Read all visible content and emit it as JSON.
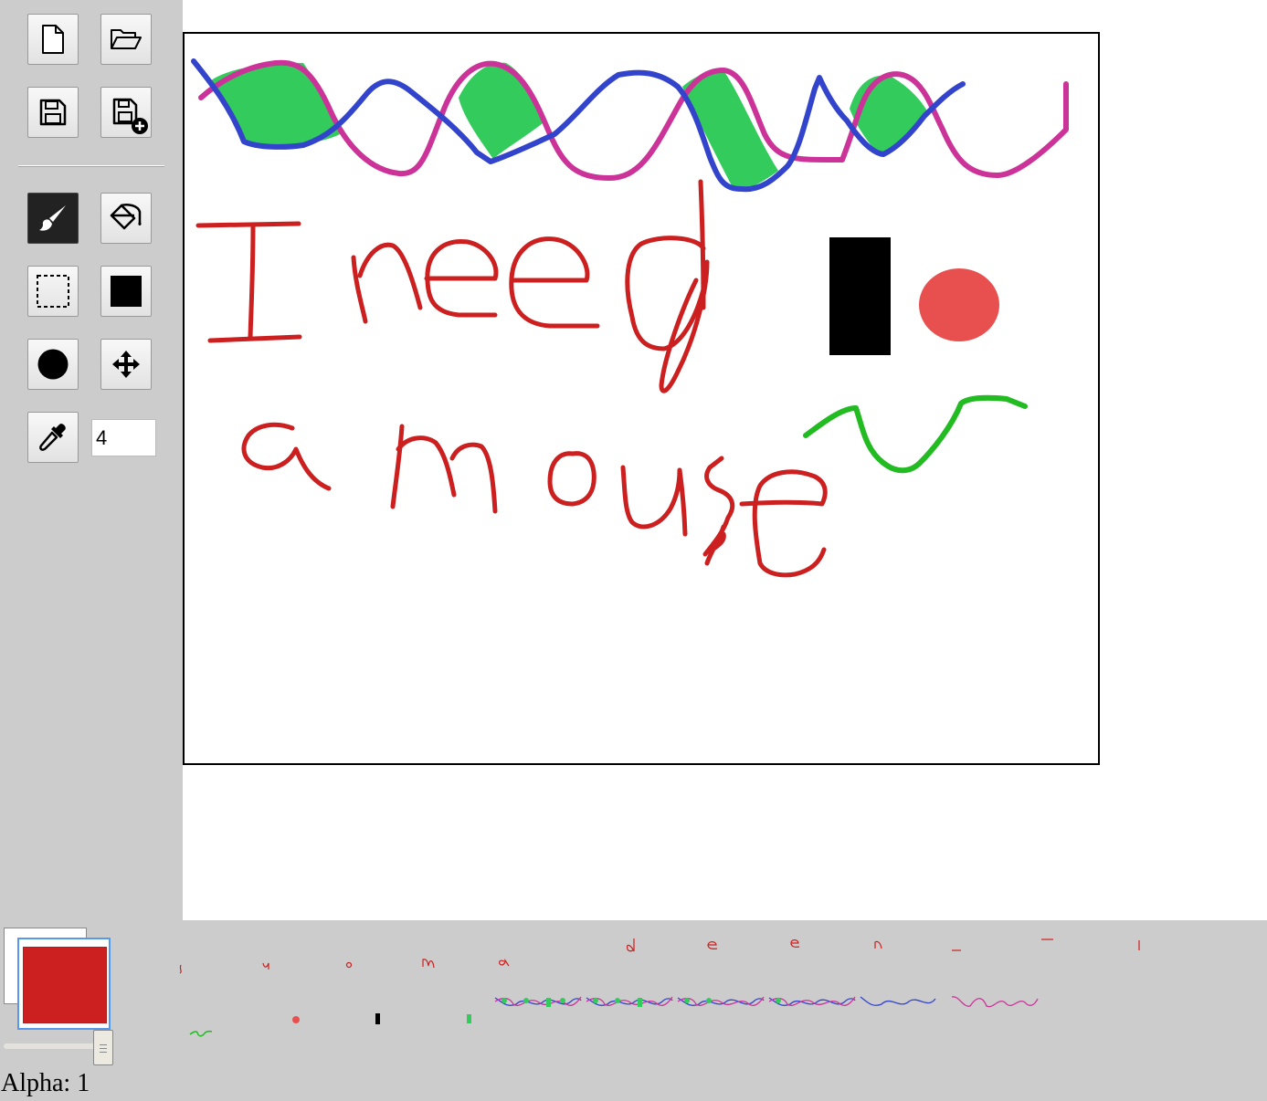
{
  "toolbar": {
    "tools": [
      {
        "name": "new-file",
        "icon": "new-file-icon",
        "active": false
      },
      {
        "name": "open-file",
        "icon": "folder-open-icon",
        "active": false
      },
      {
        "name": "save",
        "icon": "save-icon",
        "active": false
      },
      {
        "name": "save-as",
        "icon": "save-as-icon",
        "active": false
      },
      {
        "name": "brush",
        "icon": "paintbrush-icon",
        "active": true
      },
      {
        "name": "fill",
        "icon": "paint-bucket-icon",
        "active": false
      },
      {
        "name": "select",
        "icon": "dashed-select-icon",
        "active": false
      },
      {
        "name": "rectangle",
        "icon": "filled-square-icon",
        "active": false
      },
      {
        "name": "ellipse",
        "icon": "filled-circle-icon",
        "active": false
      },
      {
        "name": "move",
        "icon": "move-arrows-icon",
        "active": false
      },
      {
        "name": "eyedropper",
        "icon": "eyedropper-icon",
        "active": false
      }
    ],
    "brush_size": "4"
  },
  "colors": {
    "foreground": "#cc1f1f",
    "background": "#ffffff",
    "canvas_border": "#000000",
    "panel": "#cccccc"
  },
  "drawing": {
    "stroke_colors": {
      "handwriting": "#cc1f1f",
      "magenta_wave": "#cc3399",
      "blue_wave": "#3344cc",
      "green_fill": "#33cc5c",
      "green_squiggle": "#22bb22",
      "black_rect": "#000000",
      "red_circle": "#e85050"
    }
  },
  "alpha": {
    "label": "Alpha: 1",
    "value": 1
  },
  "history": {
    "items": [
      "s",
      "u",
      "o",
      "m",
      "a",
      "d",
      "e",
      "e",
      "n",
      "-",
      "-",
      "I",
      "green-squiggle",
      "red-circle",
      "black-rect",
      "green-fill",
      "waves",
      "waves",
      "waves",
      "waves",
      "blue-wave",
      "magenta-wave"
    ]
  }
}
